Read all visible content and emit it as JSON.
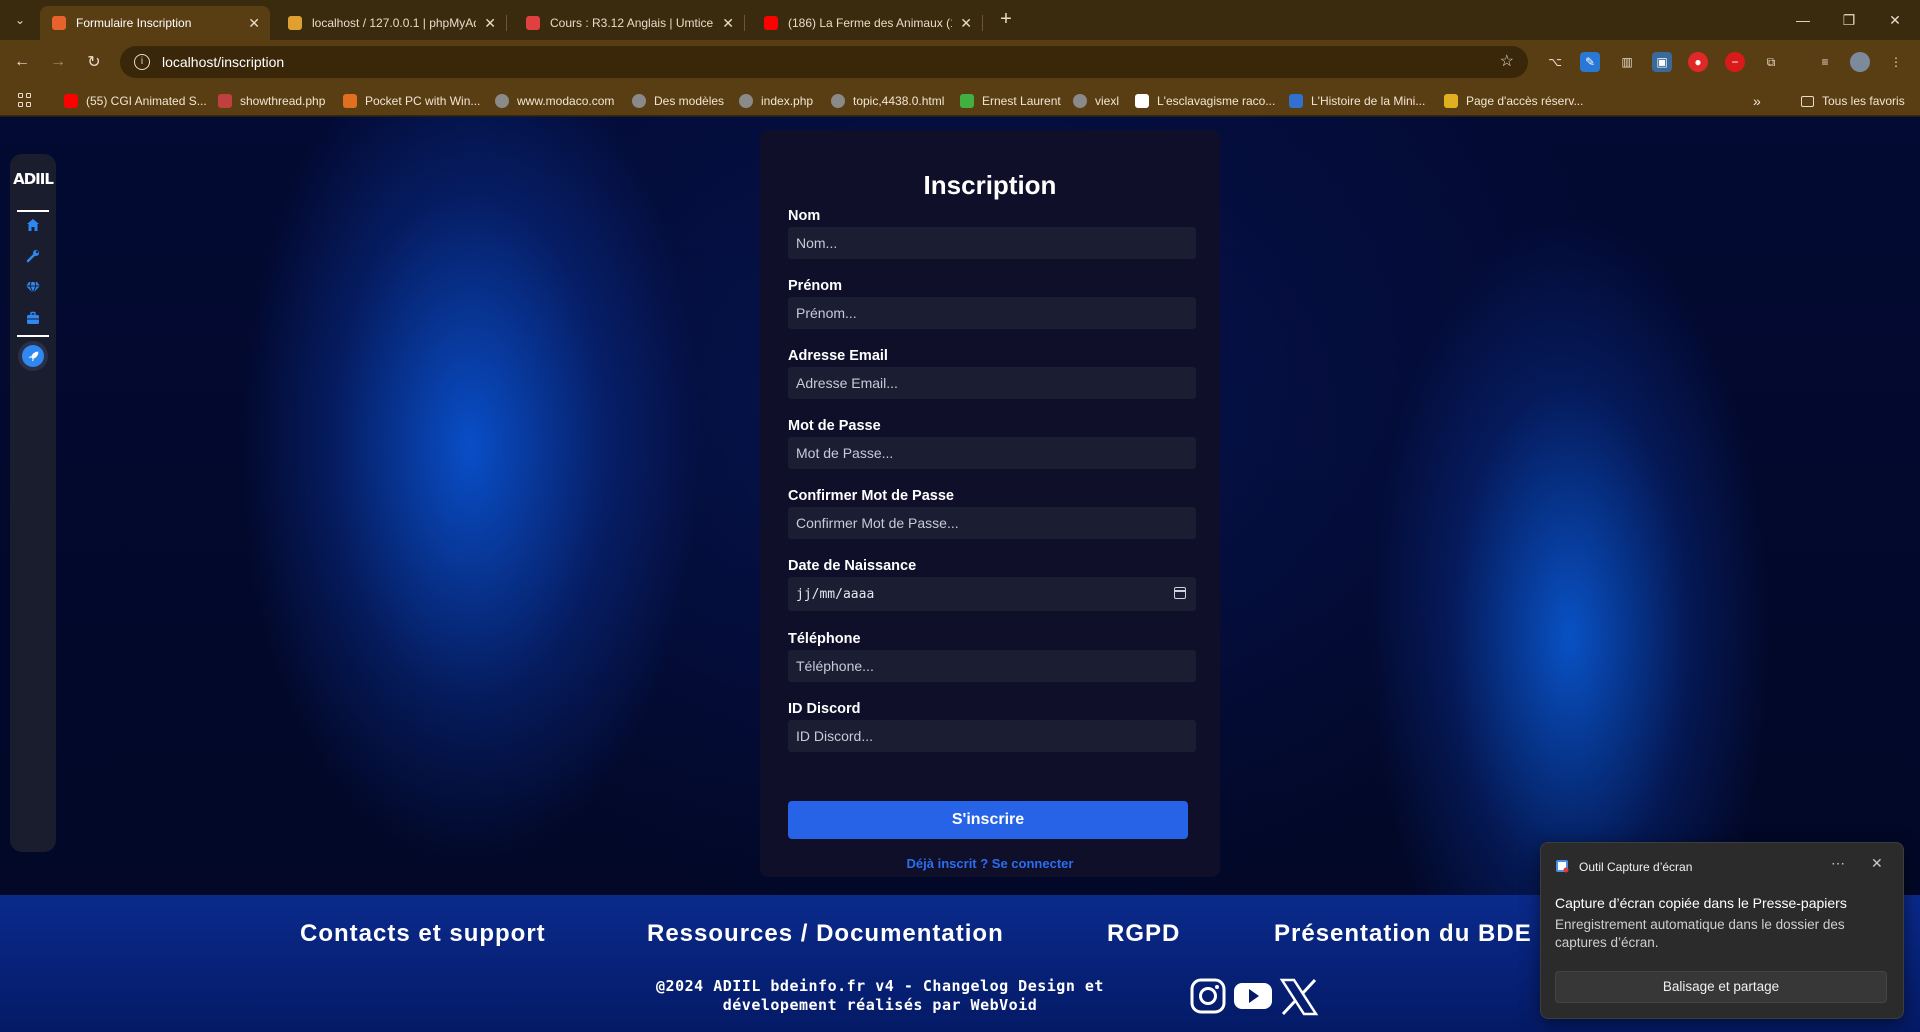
{
  "browser": {
    "tabs": [
      {
        "title": "Formulaire Inscription",
        "active": true,
        "favicon_color": "#e8632c"
      },
      {
        "title": "localhost / 127.0.0.1 | phpMyAd",
        "active": false,
        "favicon_color": "#e0a030"
      },
      {
        "title": "Cours : R3.12 Anglais | Umtice",
        "active": false,
        "favicon_color": "#e04040"
      },
      {
        "title": "(186) La Ferme des Animaux (1",
        "active": false,
        "favicon_color": "#ff0000"
      }
    ],
    "url": "localhost/inscription",
    "bookmarks": [
      {
        "label": "(55) CGI Animated S...",
        "icon_color": "#ff0000"
      },
      {
        "label": "showthread.php",
        "icon_color": "#c04040"
      },
      {
        "label": "Pocket PC with Win...",
        "icon_color": "#e07020"
      },
      {
        "label": "www.modaco.com",
        "icon_color": "#8a8a8a"
      },
      {
        "label": "Des modèles",
        "icon_color": "#8a8a8a"
      },
      {
        "label": "index.php",
        "icon_color": "#8a8a8a"
      },
      {
        "label": "topic,4438.0.html",
        "icon_color": "#8a8a8a"
      },
      {
        "label": "Ernest Laurent",
        "icon_color": "#40b040"
      },
      {
        "label": "viexl",
        "icon_color": "#8a8a8a"
      },
      {
        "label": "L'esclavagisme raco...",
        "icon_color": "#ffffff"
      },
      {
        "label": "L'Histoire de la Mini...",
        "icon_color": "#3070d0"
      },
      {
        "label": "Page d'accès réserv...",
        "icon_color": "#e0b020"
      }
    ],
    "all_favorites": "Tous les favoris"
  },
  "sidebar": {
    "logo": "ADIIL",
    "accent": "#2f88f0"
  },
  "form": {
    "title": "Inscription",
    "fields": [
      {
        "label": "Nom",
        "placeholder": "Nom..."
      },
      {
        "label": "Prénom",
        "placeholder": "Prénom..."
      },
      {
        "label": "Adresse Email",
        "placeholder": "Adresse Email..."
      },
      {
        "label": "Mot de Passe",
        "placeholder": "Mot de Passe..."
      },
      {
        "label": "Confirmer Mot de Passe",
        "placeholder": "Confirmer Mot de Passe..."
      },
      {
        "label": "Date de Naissance",
        "placeholder": "jj/mm/aaaa"
      },
      {
        "label": "Téléphone",
        "placeholder": "Téléphone..."
      },
      {
        "label": "ID Discord",
        "placeholder": "ID Discord..."
      }
    ],
    "submit_label": "S'inscrire",
    "login_link": "Déjà inscrit ? Se connecter",
    "button_color": "#2763e6"
  },
  "footer": {
    "links": [
      "Contacts et support",
      "Ressources / Documentation",
      "RGPD",
      "Présentation du BDE"
    ],
    "copyright_line1": "@2024 ADIIL bdeinfo.fr v4 - Changelog Design et",
    "copyright_line2": "dévelopement réalisés par WebVoid",
    "socials": [
      "instagram-icon",
      "youtube-icon",
      "x-icon"
    ]
  },
  "toast": {
    "app_name": "Outil Capture d’écran",
    "title": "Capture d’écran copiée dans le Presse-papiers",
    "body": "Enregistrement automatique dans le dossier des captures d’écran.",
    "action": "Balisage et partage"
  }
}
